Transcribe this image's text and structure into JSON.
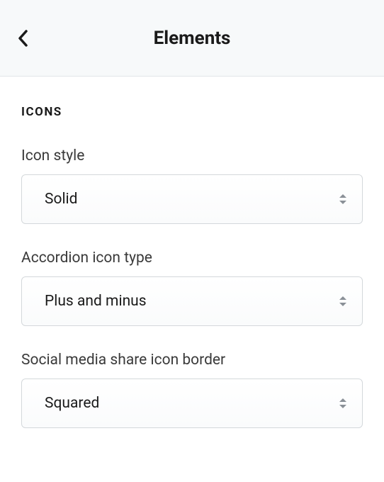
{
  "header": {
    "title": "Elements"
  },
  "section": {
    "title": "ICONS"
  },
  "fields": {
    "iconStyle": {
      "label": "Icon style",
      "value": "Solid"
    },
    "accordionIconType": {
      "label": "Accordion icon type",
      "value": "Plus and minus"
    },
    "socialMediaBorder": {
      "label": "Social media share icon border",
      "value": "Squared"
    }
  }
}
